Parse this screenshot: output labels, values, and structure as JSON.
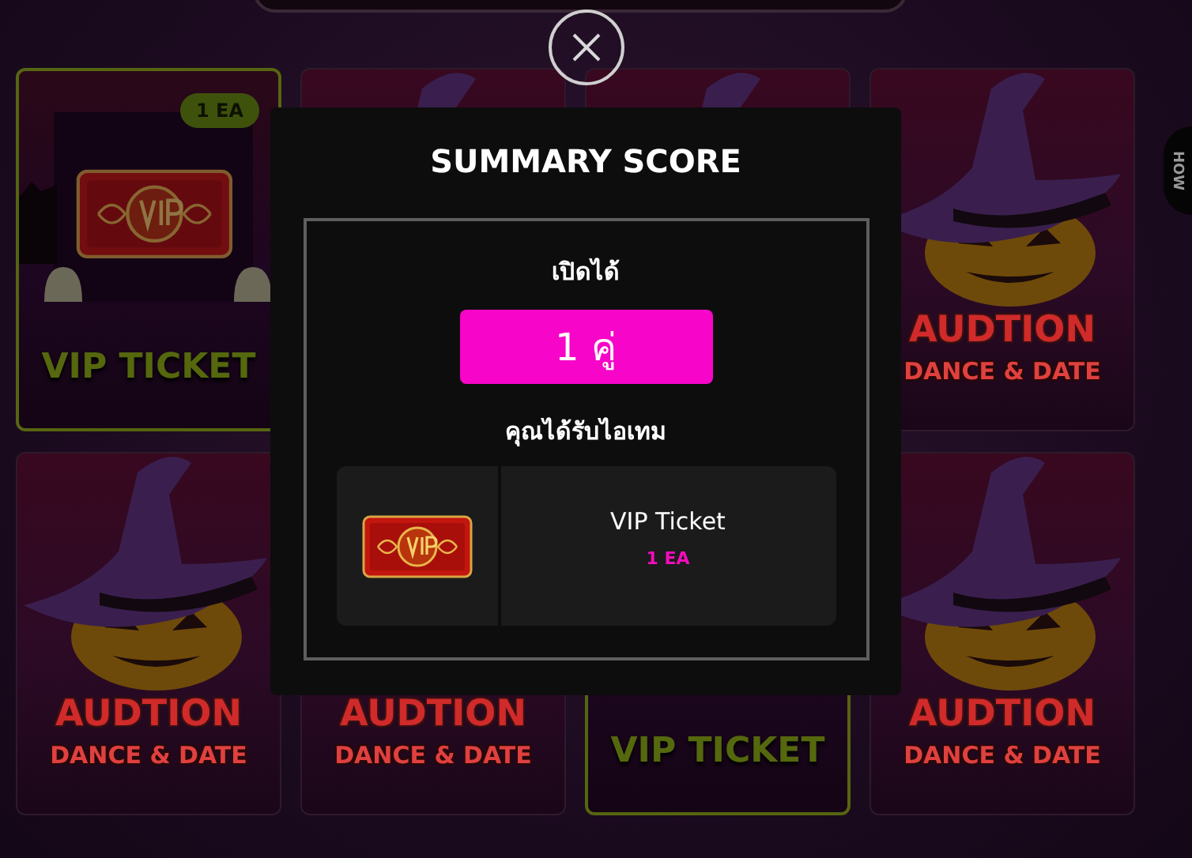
{
  "help_button": {
    "label": "HOW"
  },
  "cards": [
    {
      "kind": "vip",
      "highlighted": true,
      "badge": "1 EA",
      "title": "VIP TICKET"
    },
    {
      "kind": "audtion",
      "highlighted": false
    },
    {
      "kind": "audtion",
      "highlighted": false
    },
    {
      "kind": "audtion",
      "highlighted": false,
      "title": "AUDTION",
      "subtitle": "DANCE & DATE"
    },
    {
      "kind": "audtion",
      "highlighted": false,
      "title": "AUDTION",
      "subtitle": "DANCE & DATE"
    },
    {
      "kind": "audtion",
      "highlighted": false,
      "title": "AUDTION",
      "subtitle": "DANCE & DATE"
    },
    {
      "kind": "vip",
      "highlighted": true,
      "title": "VIP TICKET"
    },
    {
      "kind": "audtion",
      "highlighted": false,
      "title": "AUDTION",
      "subtitle": "DANCE & DATE"
    }
  ],
  "modal": {
    "title": "SUMMARY SCORE",
    "opened_label": "เปิดได้",
    "opened_count": "1 คู่",
    "items_label": "คุณได้รับไอเทม",
    "items": [
      {
        "name": "VIP Ticket",
        "quantity": "1 EA"
      }
    ]
  }
}
